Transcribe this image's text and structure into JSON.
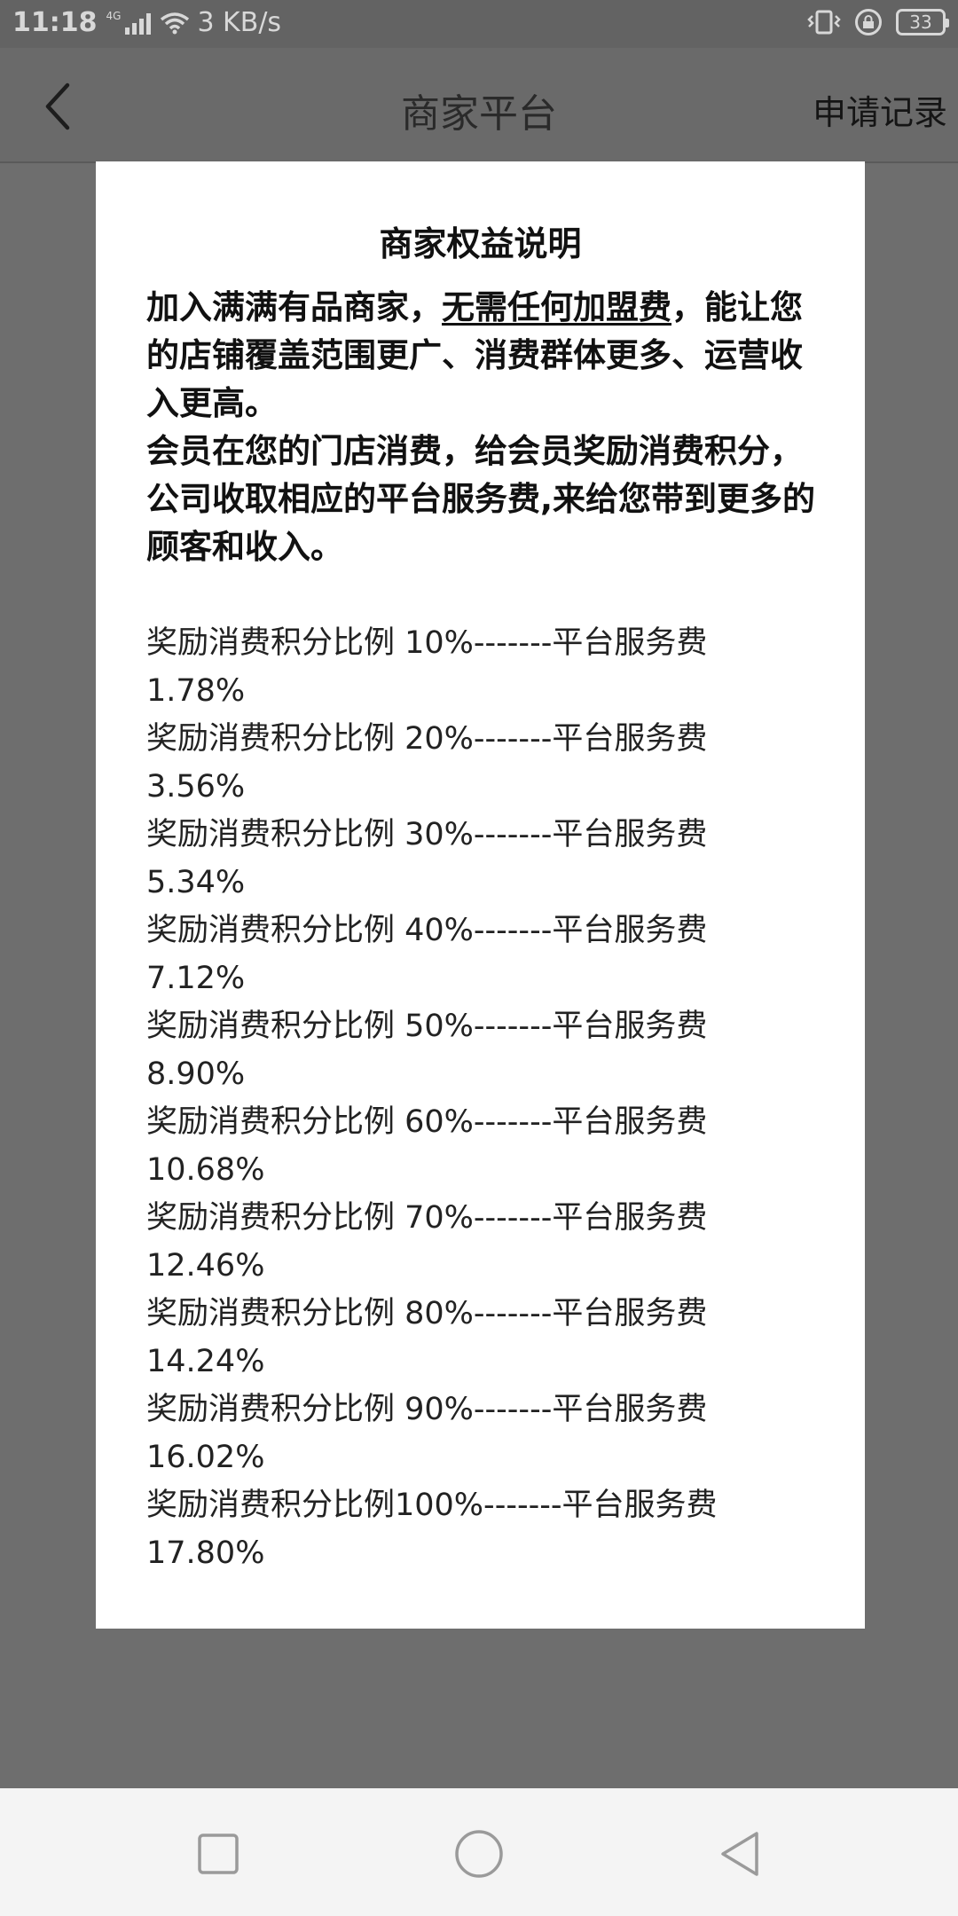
{
  "status_bar": {
    "time": "11:18",
    "network_type": "4G",
    "speed": "3 KB/s",
    "battery": "33",
    "icons": [
      "signal-icon",
      "wifi-icon",
      "vibrate-icon",
      "lock-rotation-icon",
      "battery-icon"
    ]
  },
  "nav": {
    "title": "商家平台",
    "action": "申请记录",
    "back_icon": "chevron-left-icon"
  },
  "modal": {
    "title": "商家权益说明",
    "intro_part1": "加入满满有品商家，",
    "intro_underlined": "无需任何加盟费",
    "intro_part2": "，能让您的店铺覆盖范围更广、消费群体更多、运营收入更高。",
    "intro_para2": "会员在您的门店消费，给会员奖励消费积分，公司收取相应的平台服务费,来给您带到更多的顾客和收入。",
    "rates": [
      {
        "text": "奖励消费积分比例  10%-------平台服务费1.78%"
      },
      {
        "text": "奖励消费积分比例  20%-------平台服务费3.56%"
      },
      {
        "text": "奖励消费积分比例  30%-------平台服务费5.34%"
      },
      {
        "text": "奖励消费积分比例  40%-------平台服务费7.12%"
      },
      {
        "text": "奖励消费积分比例  50%-------平台服务费8.90%"
      },
      {
        "text": "奖励消费积分比例  60%-------平台服务费10.68%"
      },
      {
        "text": "奖励消费积分比例  70%-------平台服务费12.46%"
      },
      {
        "text": "奖励消费积分比例  80%-------平台服务费14.24%"
      },
      {
        "text": "奖励消费积分比例  90%-------平台服务费16.02%"
      },
      {
        "text": "奖励消费积分比例100%-------平台服务费17.80%"
      }
    ]
  },
  "system_nav": {
    "icons": [
      "recent-apps-icon",
      "home-icon",
      "back-icon"
    ]
  },
  "colors": {
    "overlay": "#6e6e6e",
    "modal_bg": "#ffffff",
    "text": "#111111",
    "home_bar": "#f4f4f4"
  }
}
